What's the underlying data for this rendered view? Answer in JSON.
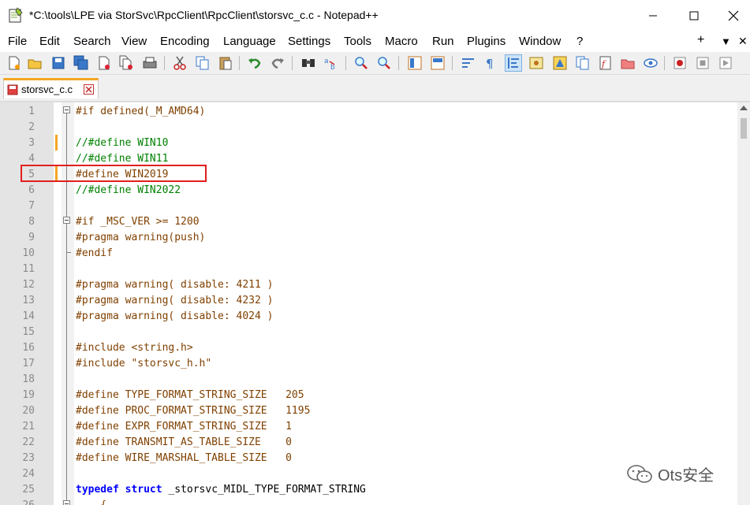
{
  "window": {
    "title": "*C:\\tools\\LPE via StorSvc\\RpcClient\\RpcClient\\storsvc_c.c - Notepad++",
    "minimize": "—",
    "maximize": "☐",
    "close": "✕"
  },
  "menu": {
    "items": [
      "File",
      "Edit",
      "Search",
      "View",
      "Encoding",
      "Language",
      "Settings",
      "Tools",
      "Macro",
      "Run",
      "Plugins",
      "Window",
      "?"
    ],
    "right_items": [
      "+",
      "▼",
      "✕"
    ]
  },
  "tab": {
    "label": "storsvc_c.c"
  },
  "editor": {
    "lines": [
      {
        "n": "1",
        "text": "#if defined(_M_AMD64)",
        "style": "pre"
      },
      {
        "n": "2",
        "text": "",
        "style": "pre"
      },
      {
        "n": "3",
        "text": "//#define WIN10",
        "style": "comment"
      },
      {
        "n": "4",
        "text": "//#define WIN11",
        "style": "comment"
      },
      {
        "n": "5",
        "text": "#define WIN2019",
        "style": "pre"
      },
      {
        "n": "6",
        "text": "//#define WIN2022",
        "style": "comment"
      },
      {
        "n": "7",
        "text": "",
        "style": "pre"
      },
      {
        "n": "8",
        "text": "#if _MSC_VER >= 1200",
        "style": "pre"
      },
      {
        "n": "9",
        "text": "#pragma warning(push)",
        "style": "pre"
      },
      {
        "n": "10",
        "text": "#endif",
        "style": "pre"
      },
      {
        "n": "11",
        "text": "",
        "style": "pre"
      },
      {
        "n": "12",
        "text": "#pragma warning( disable: 4211 )",
        "style": "pre"
      },
      {
        "n": "13",
        "text": "#pragma warning( disable: 4232 )",
        "style": "pre"
      },
      {
        "n": "14",
        "text": "#pragma warning( disable: 4024 )",
        "style": "pre"
      },
      {
        "n": "15",
        "text": "",
        "style": "pre"
      },
      {
        "n": "16",
        "text": "#include <string.h>",
        "style": "pre"
      },
      {
        "n": "17",
        "text": "#include \"storsvc_h.h\"",
        "style": "pre"
      },
      {
        "n": "18",
        "text": "",
        "style": "pre"
      },
      {
        "n": "19",
        "text": "#define TYPE_FORMAT_STRING_SIZE   205",
        "style": "pre"
      },
      {
        "n": "20",
        "text": "#define PROC_FORMAT_STRING_SIZE   1195",
        "style": "pre"
      },
      {
        "n": "21",
        "text": "#define EXPR_FORMAT_STRING_SIZE   1",
        "style": "pre"
      },
      {
        "n": "22",
        "text": "#define TRANSMIT_AS_TABLE_SIZE    0",
        "style": "pre"
      },
      {
        "n": "23",
        "text": "#define WIRE_MARSHAL_TABLE_SIZE   0",
        "style": "pre"
      },
      {
        "n": "24",
        "text": "",
        "style": "pre"
      },
      {
        "n": "25",
        "keyword1": "typedef",
        "keyword2": "struct",
        "rest": " _storsvc_MIDL_TYPE_FORMAT_STRING",
        "style": "typedef"
      },
      {
        "n": "26",
        "text": "    {",
        "style": "pre"
      }
    ]
  },
  "watermark": {
    "text": "Ots安全"
  },
  "colors": {
    "preprocessor": "#804000",
    "comment": "#008000",
    "keyword": "#0000ff",
    "highlight_box": "#e0201f",
    "change_marker": "#f5a623"
  }
}
